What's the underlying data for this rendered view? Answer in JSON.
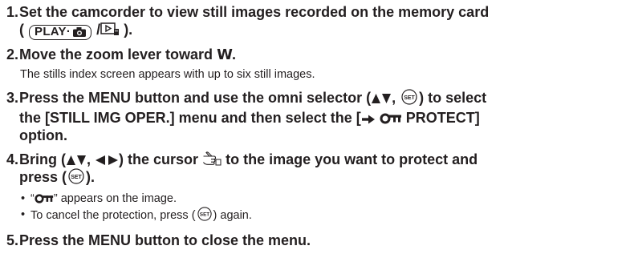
{
  "steps": [
    {
      "num": "1.",
      "text_a": "Set the camcorder to view still images recorded on the memory card",
      "open_paren": "(",
      "play_label": "PLAY·",
      "separator": "/",
      "close_paren": ")."
    },
    {
      "num": "2.",
      "text_a": "Move the zoom lever toward",
      "zoom_letter": "W",
      "text_b": ".",
      "note": "The stills index screen appears with up to six still images."
    },
    {
      "num": "3.",
      "text_a": "Press the MENU button and use the omni selector (",
      "text_b": ",",
      "text_c": ") to select",
      "text_d": "the [STILL IMG OPER.] menu and then select the [",
      "text_e": "PROTECT]",
      "text_f": "option."
    },
    {
      "num": "4.",
      "text_a": "Bring (",
      "text_b": ",",
      "text_c": ") the cursor",
      "text_d": "to the image you want to protect and",
      "text_e": "press (",
      "text_f": ").",
      "bullets": [
        {
          "pre": "“",
          "post": "” appears on the image."
        },
        {
          "pre": "To cancel the protection, press (",
          "post": ") again."
        }
      ]
    },
    {
      "num": "5.",
      "text_a": "Press the MENU button to close the menu."
    }
  ],
  "icons": {
    "camera": "camera-icon",
    "playback_card": "card-playback-icon",
    "set_button": "set-button-icon",
    "up_down": "up-down-arrows-icon",
    "left_right": "left-right-arrows-icon",
    "key": "protect-key-icon",
    "cursor": "pointing-hand-cursor-icon",
    "arrow": "right-arrow-icon"
  },
  "bullet_char": "•",
  "set_label": "SET"
}
